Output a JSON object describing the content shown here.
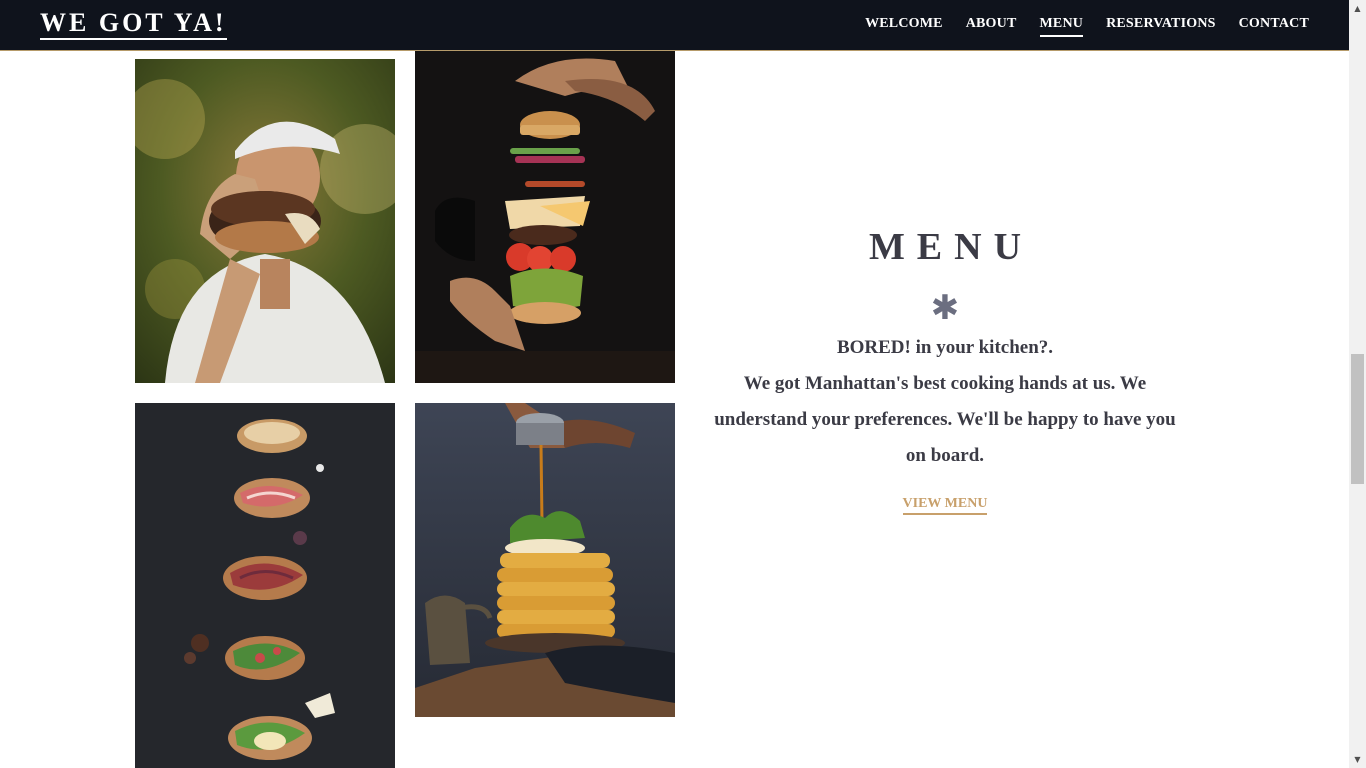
{
  "nav": {
    "brand": "WE GOT YA!",
    "links": [
      "WELCOME",
      "ABOUT",
      "MENU",
      "RESERVATIONS",
      "CONTACT"
    ],
    "active_index": 2
  },
  "gallery": {
    "images": [
      {
        "icon": "man-holding-burger-photo"
      },
      {
        "icon": "floating-burger-layers-photo"
      },
      {
        "icon": "bruschetta-row-photo"
      },
      {
        "icon": "pancake-stack-syrup-photo"
      }
    ]
  },
  "menu": {
    "title": "MENU",
    "divider": "✱",
    "line1": "BORED! in your kitchen?.",
    "line2": "We got Manhattan's best cooking hands at us. We understand your preferences. We'll be happy to have you on board.",
    "cta": "VIEW MENU"
  },
  "colors": {
    "navbar_bg": "#0f131c",
    "accent": "#c8a06b",
    "text": "#3b3b45"
  },
  "scrollbar": {
    "up": "▲",
    "down": "▼"
  }
}
